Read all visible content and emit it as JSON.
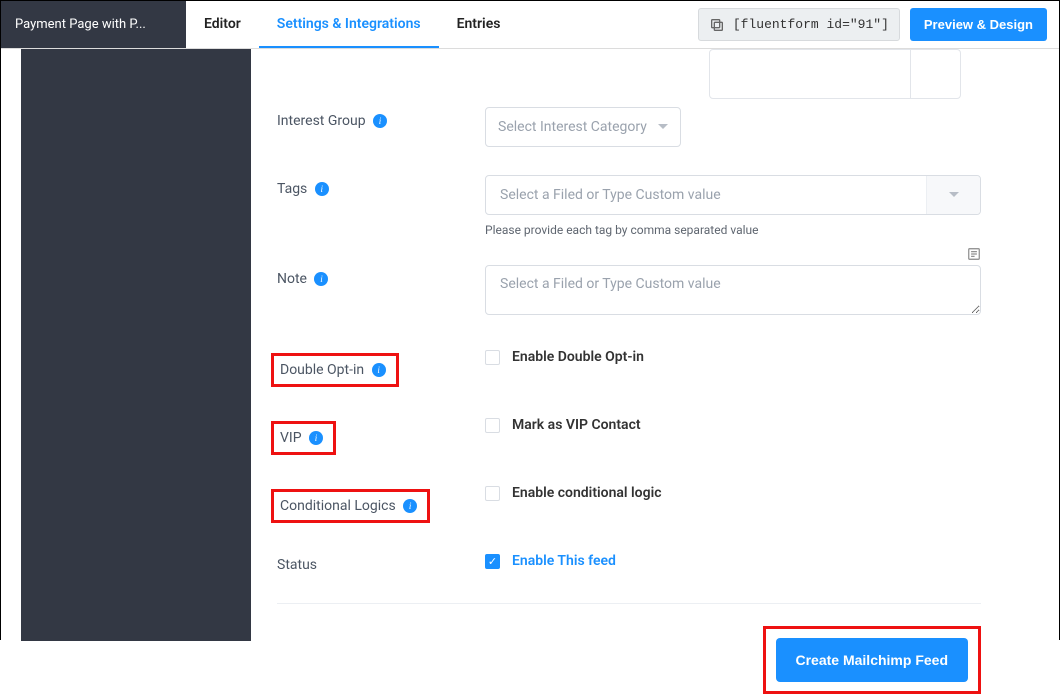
{
  "header": {
    "title": "Payment Page with P...",
    "tabs": {
      "editor": "Editor",
      "settings": "Settings & Integrations",
      "entries": "Entries"
    },
    "shortcode": "[fluentform id=\"91\"]",
    "preview": "Preview & Design"
  },
  "fields": {
    "interest_group": {
      "label": "Interest Group",
      "placeholder": "Select Interest Category"
    },
    "tags": {
      "label": "Tags",
      "placeholder": "Select a Filed or Type Custom value",
      "helper": "Please provide each tag by comma separated value"
    },
    "note": {
      "label": "Note",
      "placeholder": "Select a Filed or Type Custom value"
    },
    "double_optin": {
      "label": "Double Opt-in",
      "checkbox": "Enable Double Opt-in"
    },
    "vip": {
      "label": "VIP",
      "checkbox": "Mark as VIP Contact"
    },
    "conditional": {
      "label": "Conditional Logics",
      "checkbox": "Enable conditional logic"
    },
    "status": {
      "label": "Status",
      "checkbox": "Enable This feed"
    }
  },
  "submit": {
    "create": "Create Mailchimp Feed"
  },
  "icons": {
    "info": "i",
    "check": "✓"
  }
}
